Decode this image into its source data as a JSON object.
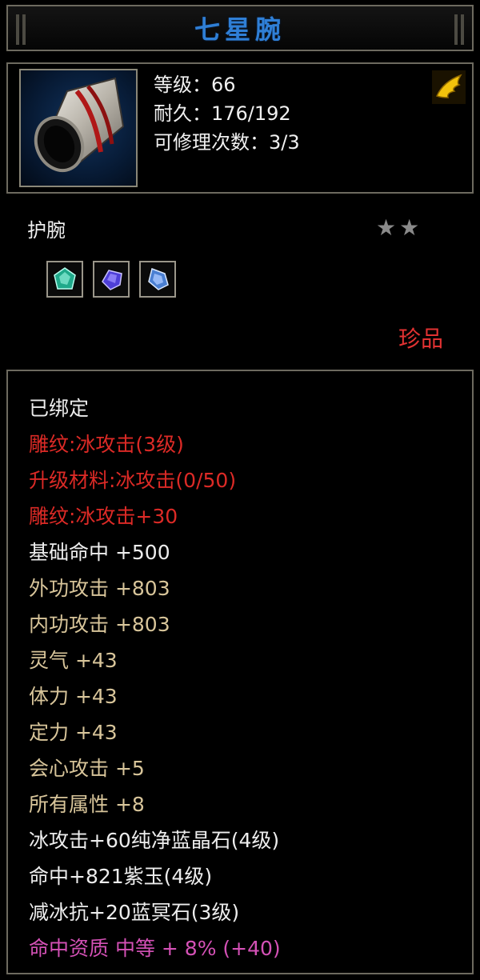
{
  "item": {
    "name": "七星腕",
    "level_line": "等级：66",
    "durability_line": "耐久：176/192",
    "repair_line": "可修理次数：3/3",
    "type": "护腕",
    "stars": "★★",
    "rarity": "珍品",
    "icon": "bracer-item-icon",
    "flag_icon": "gold-wing-icon",
    "gems": [
      "green-gem-icon",
      "purple-gem-icon",
      "blue-gem-icon"
    ]
  },
  "attributes": [
    {
      "text": "已绑定",
      "color": "white"
    },
    {
      "text": "雕纹:冰攻击(3级)",
      "color": "red"
    },
    {
      "text": "升级材料:冰攻击(0/50)",
      "color": "red"
    },
    {
      "text": "雕纹:冰攻击+30",
      "color": "red"
    },
    {
      "text": "基础命中  +500",
      "color": "white"
    },
    {
      "text": "外功攻击  +803",
      "color": "tan"
    },
    {
      "text": "内功攻击  +803",
      "color": "tan"
    },
    {
      "text": "灵气  +43",
      "color": "tan"
    },
    {
      "text": "体力  +43",
      "color": "tan"
    },
    {
      "text": "定力  +43",
      "color": "tan"
    },
    {
      "text": "会心攻击  +5",
      "color": "tan"
    },
    {
      "text": "所有属性  +8",
      "color": "tan"
    },
    {
      "text": "冰攻击+60纯净蓝晶石(4级)",
      "color": "white"
    },
    {
      "text": "命中+821紫玉(4级)",
      "color": "white"
    },
    {
      "text": "减冰抗+20蓝冥石(3级)",
      "color": "white"
    },
    {
      "text": "命中资质  中等  +  8% (+40)",
      "color": "pink"
    }
  ]
}
